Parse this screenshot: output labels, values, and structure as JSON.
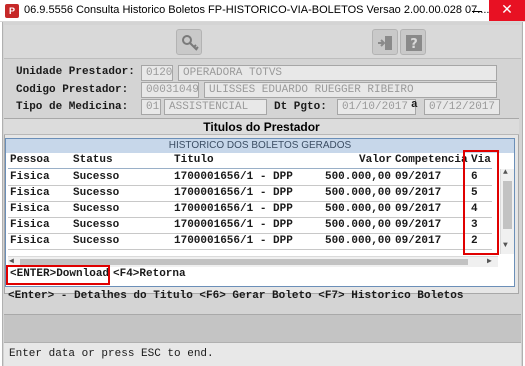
{
  "window": {
    "title": "06.9.5556  Consulta Historico Boletos FP-HISTORICO-VIA-BOLETOS Versao 2.00.00.028 07....",
    "app_icon": "app-icon",
    "close_glyph": "✕"
  },
  "toolbar": {
    "icons": [
      "key-icon",
      "exit-door-icon",
      "help-question-icon"
    ]
  },
  "header": {
    "unidade_label": "Unidade Prestador:",
    "unidade_code": "0120",
    "unidade_name": "OPERADORA TOTVS",
    "codigo_label": "Codigo Prestador:",
    "codigo_code": "00031049",
    "codigo_name": "ULISSES EDUARDO RUEGGER RIBEIRO",
    "tipo_label": "Tipo de Medicina:",
    "tipo_code": "01",
    "tipo_name": "ASSISTENCIAL",
    "dtpgto_label": "Dt Pgto:",
    "dtpgto_from": "01/10/2017",
    "dtpgto_sep": "a",
    "dtpgto_to": "07/12/2017"
  },
  "titulos_section": {
    "title": "Titulos do Prestador"
  },
  "popup": {
    "title": "HISTORICO DOS BOLETOS GERADOS",
    "columns": {
      "pessoa": "Pessoa",
      "status": "Status",
      "titulo": "Titulo",
      "valor": "Valor",
      "competencia": "Competencia",
      "via": "Via"
    },
    "rows": [
      {
        "pessoa": "Fisica",
        "status": "Sucesso",
        "titulo": "1700001656/1 - DPP",
        "valor": "500.000,00",
        "competencia": "09/2017",
        "via": "6"
      },
      {
        "pessoa": "Fisica",
        "status": "Sucesso",
        "titulo": "1700001656/1 - DPP",
        "valor": "500.000,00",
        "competencia": "09/2017",
        "via": "5"
      },
      {
        "pessoa": "Fisica",
        "status": "Sucesso",
        "titulo": "1700001656/1 - DPP",
        "valor": "500.000,00",
        "competencia": "09/2017",
        "via": "4"
      },
      {
        "pessoa": "Fisica",
        "status": "Sucesso",
        "titulo": "1700001656/1 - DPP",
        "valor": "500.000,00",
        "competencia": "09/2017",
        "via": "3"
      },
      {
        "pessoa": "Fisica",
        "status": "Sucesso",
        "titulo": "1700001656/1 - DPP",
        "valor": "500.000,00",
        "competencia": "09/2017",
        "via": "2"
      }
    ],
    "scroll_up": "▲",
    "scroll_down": "▼",
    "scroll_left": "◀",
    "scroll_right": "▶",
    "enter_action": "<ENTER>Download",
    "f4_action": "<F4>Retorna"
  },
  "info_line": "<Enter> - Detalhes do Titulo  <F6> Gerar Boleto  <F7> Historico Boletos",
  "status_bar": "Enter data or press ESC to end.",
  "colors": {
    "highlight": "#e00000",
    "popup_header": "#c7d7ea",
    "close_button": "#e81123"
  }
}
